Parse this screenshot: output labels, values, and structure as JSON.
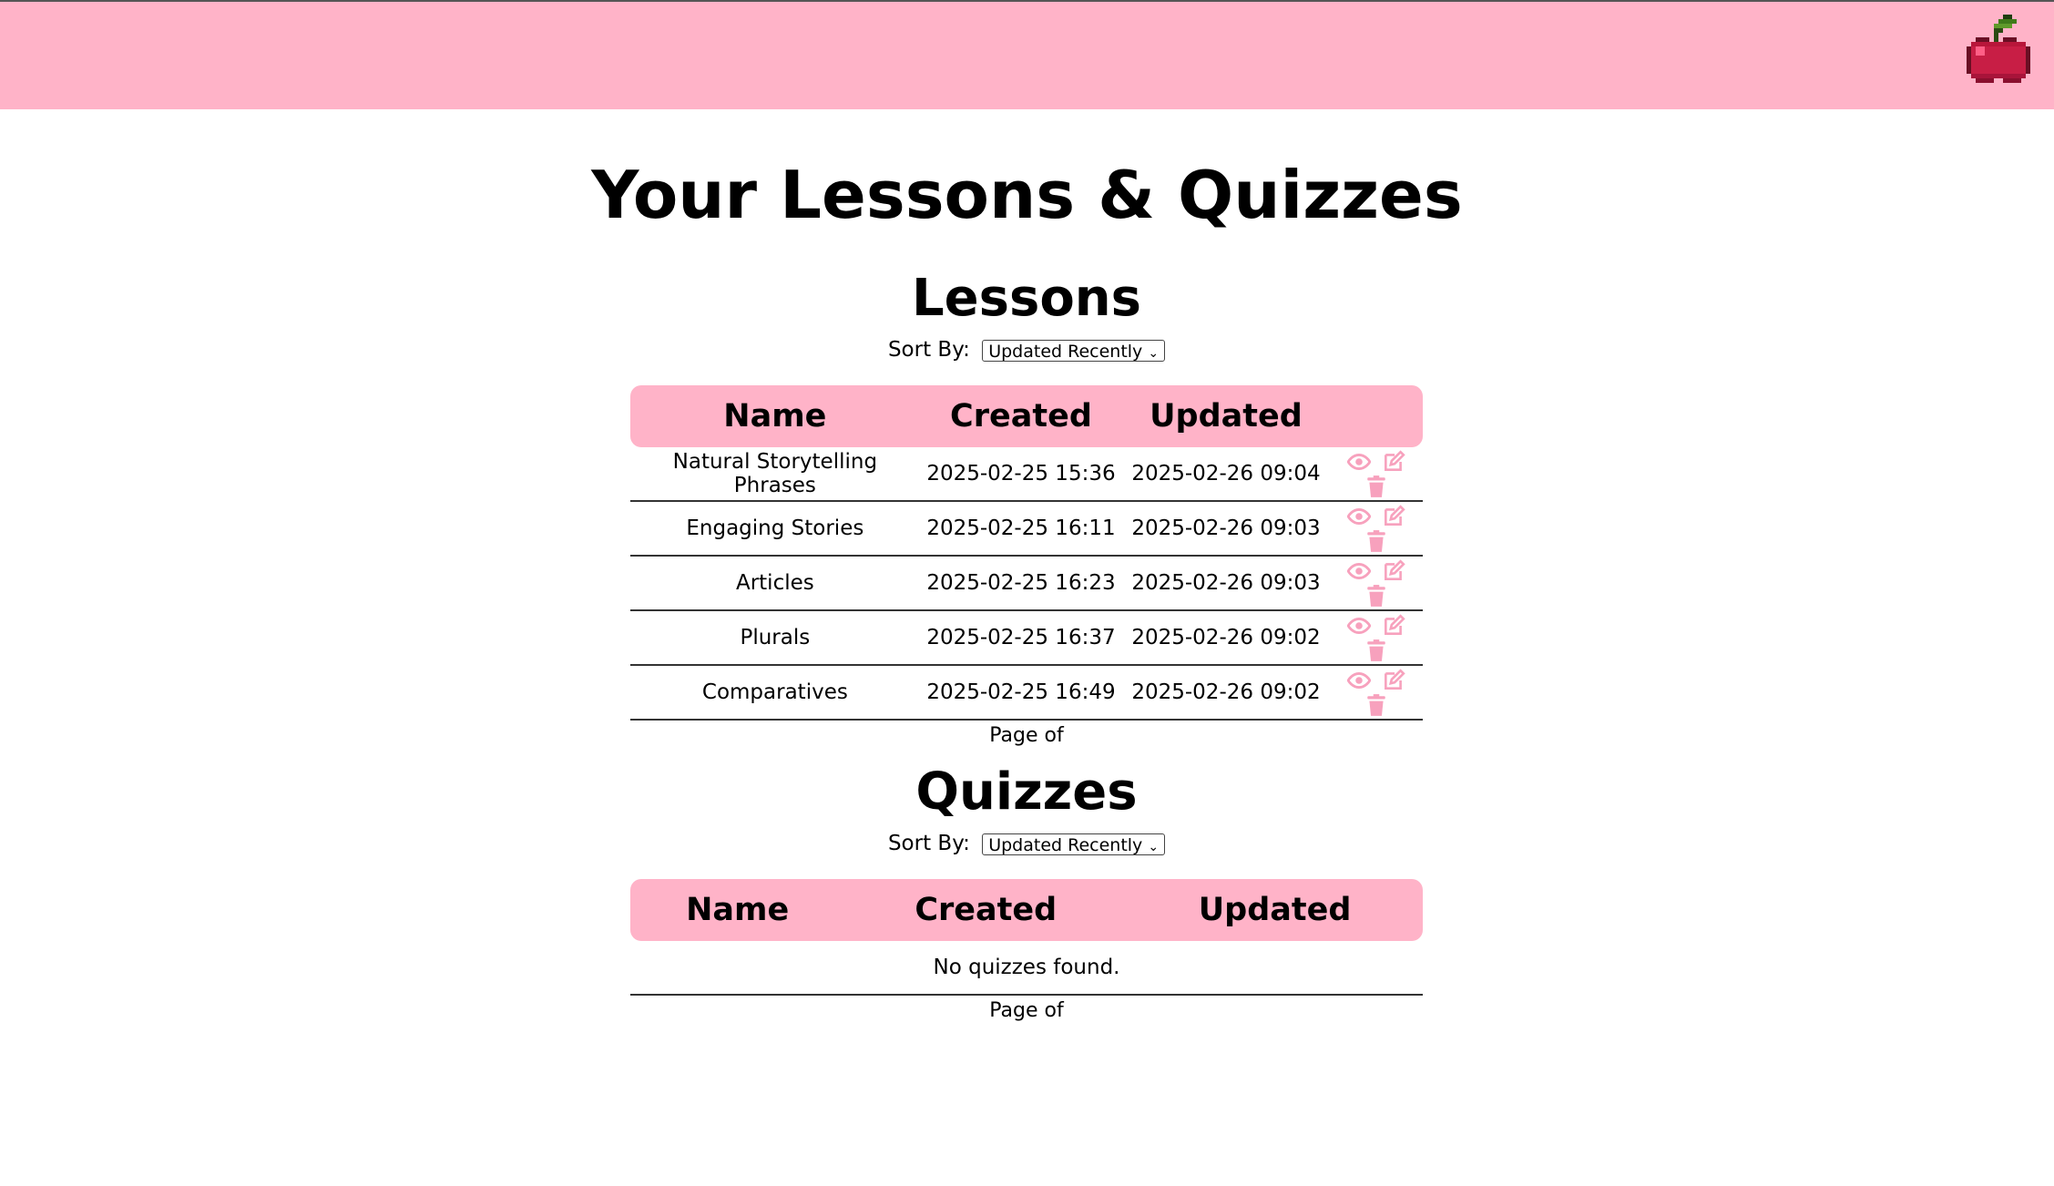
{
  "header": {
    "logo_icon": "cherry-icon",
    "bar_color": "#ffb3c8"
  },
  "page": {
    "title": "Your Lessons & Quizzes"
  },
  "lessons": {
    "heading": "Lessons",
    "sort_label": "Sort By:",
    "sort_value": "Updated Recently",
    "columns": [
      "Name",
      "Created",
      "Updated"
    ],
    "rows": [
      {
        "name": "Natural Storytelling Phrases",
        "created": "2025-02-25 15:36",
        "updated": "2025-02-26 09:04"
      },
      {
        "name": "Engaging Stories",
        "created": "2025-02-25 16:11",
        "updated": "2025-02-26 09:03"
      },
      {
        "name": "Articles",
        "created": "2025-02-25 16:23",
        "updated": "2025-02-26 09:03"
      },
      {
        "name": "Plurals",
        "created": "2025-02-25 16:37",
        "updated": "2025-02-26 09:02"
      },
      {
        "name": "Comparatives",
        "created": "2025-02-25 16:49",
        "updated": "2025-02-26 09:02"
      }
    ],
    "row_actions": [
      "eye-icon",
      "edit-icon",
      "trash-icon"
    ],
    "pager": "Page of"
  },
  "quizzes": {
    "heading": "Quizzes",
    "sort_label": "Sort By:",
    "sort_value": "Updated Recently",
    "columns": [
      "Name",
      "Created",
      "Updated"
    ],
    "empty_text": "No quizzes found.",
    "pager": "Page of"
  },
  "colors": {
    "accent": "#ffb3c8",
    "icon": "#f7a1bd"
  }
}
